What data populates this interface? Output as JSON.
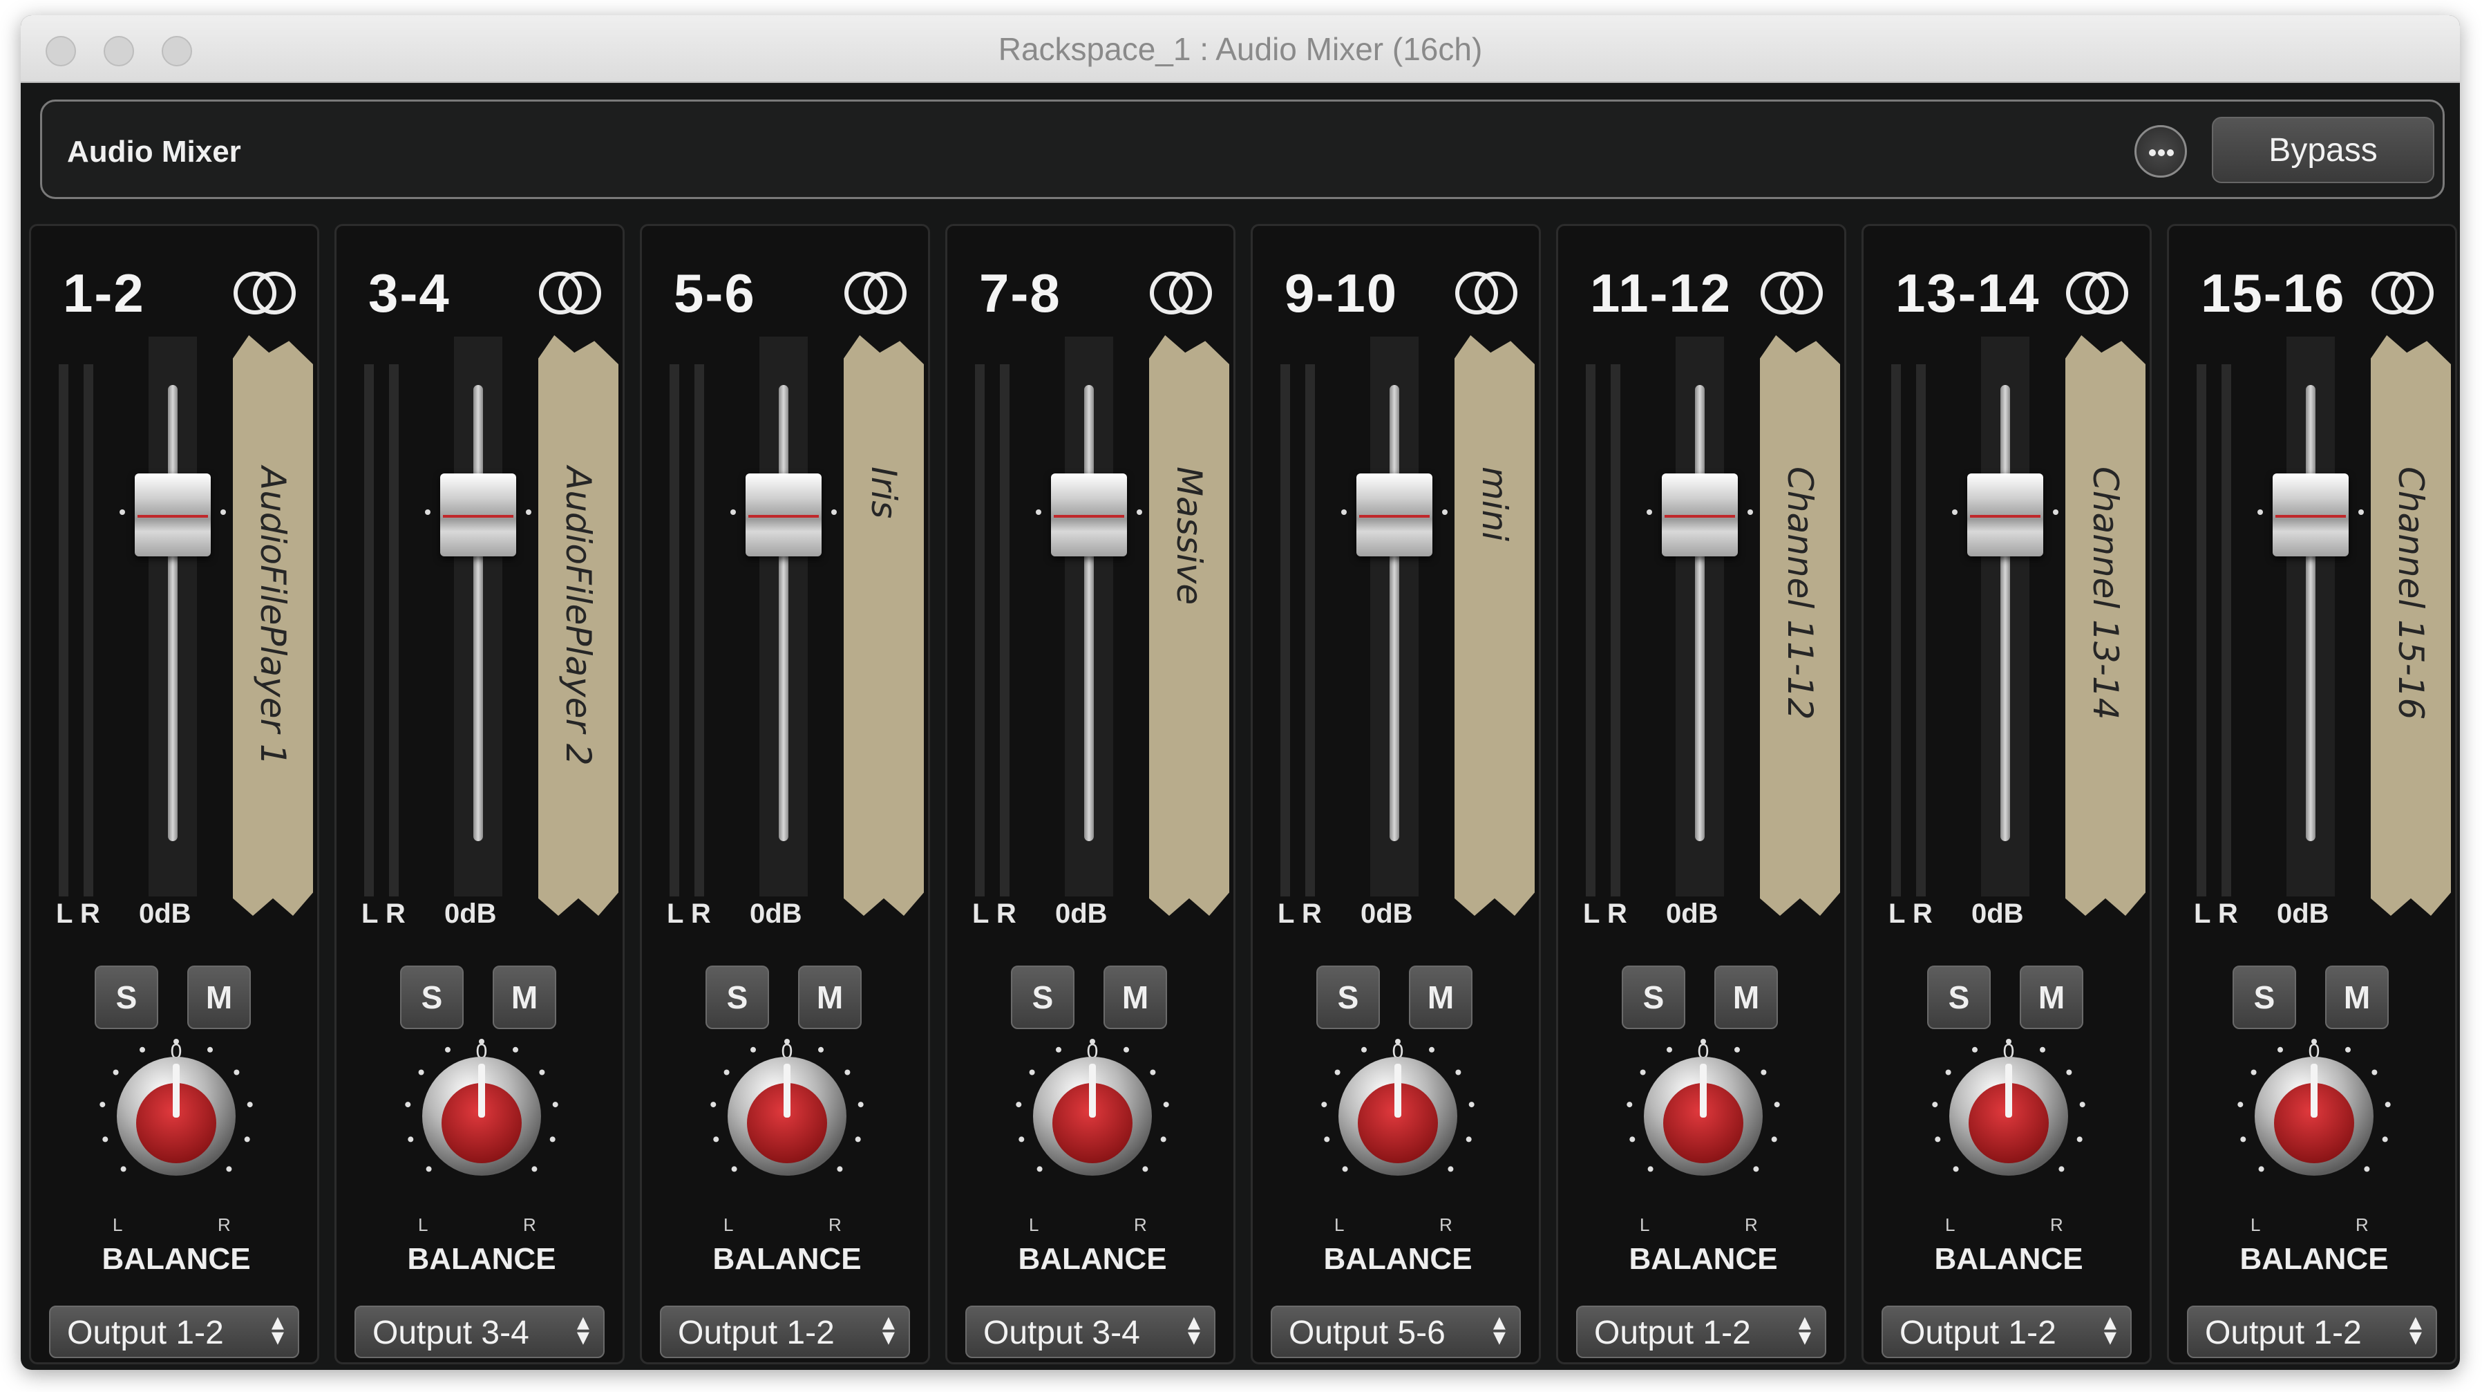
{
  "window": {
    "title": "Rackspace_1 : Audio Mixer (16ch)"
  },
  "header": {
    "title": "Audio Mixer",
    "more_icon": "ellipsis-circle-icon",
    "bypass_label": "Bypass"
  },
  "colors": {
    "panel": "#161717",
    "tape": "#b8ac8c",
    "knob_red": "#c0282b"
  },
  "channel_labels": {
    "meter": "L R",
    "fader": "0dB",
    "solo": "S",
    "mute": "M",
    "pan_center": "0",
    "pan_left": "L",
    "pan_right": "R",
    "balance": "BALANCE",
    "stereo_icon": "stereo-link-icon"
  },
  "channels": [
    {
      "number": "1-2",
      "name": "AudioFilePlayer 1",
      "output": "Output 1-2"
    },
    {
      "number": "3-4",
      "name": "AudioFilePlayer 2",
      "output": "Output 3-4"
    },
    {
      "number": "5-6",
      "name": "Iris",
      "output": "Output 1-2"
    },
    {
      "number": "7-8",
      "name": "Massive",
      "output": "Output 3-4"
    },
    {
      "number": "9-10",
      "name": "mini",
      "output": "Output 5-6"
    },
    {
      "number": "11-12",
      "name": "Channel 11-12",
      "output": "Output 1-2"
    },
    {
      "number": "13-14",
      "name": "Channel 13-14",
      "output": "Output 1-2"
    },
    {
      "number": "15-16",
      "name": "Channel 15-16",
      "output": "Output 1-2"
    }
  ]
}
